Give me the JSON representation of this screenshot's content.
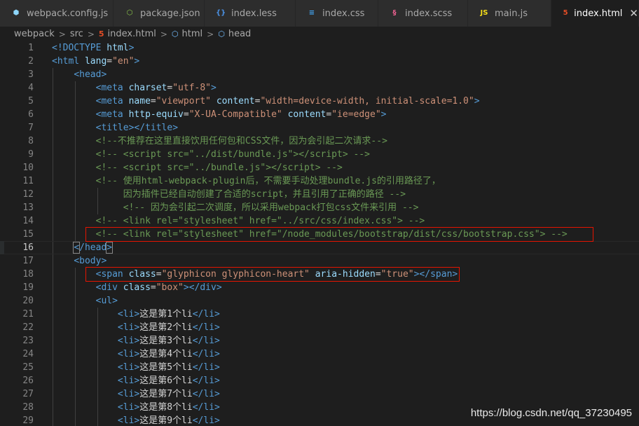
{
  "tabs": [
    {
      "label": "webpack.config.js",
      "icon": "webpack-icon",
      "color": "#8ed6fb",
      "glyph": "⬢"
    },
    {
      "label": "package.json",
      "icon": "node-icon",
      "color": "#8cc84b",
      "glyph": "⬡"
    },
    {
      "label": "index.less",
      "icon": "braces-icon",
      "color": "#4a90e2",
      "glyph": "{}"
    },
    {
      "label": "index.css",
      "icon": "css3-icon",
      "color": "#42a5f5",
      "glyph": "≡"
    },
    {
      "label": "index.scss",
      "icon": "sass-icon",
      "color": "#f06292",
      "glyph": "§"
    },
    {
      "label": "main.js",
      "icon": "javascript-icon",
      "color": "#f5de19",
      "glyph": "JS"
    },
    {
      "label": "index.html",
      "icon": "html5-icon",
      "color": "#e44d26",
      "glyph": "5",
      "active": true,
      "close": "✕"
    }
  ],
  "breadcrumb": [
    "webpack",
    "src",
    "index.html",
    "html",
    "head"
  ],
  "lines": [
    {
      "n": "1",
      "html": "<span class='t'>&lt;!DOCTYPE</span> <span class='a'>html</span><span class='t'>&gt;</span>"
    },
    {
      "n": "2",
      "html": "<span class='t'>&lt;html</span> <span class='a'>lang</span><span class='txt'>=</span><span class='s'>\"en\"</span><span class='t'>&gt;</span>"
    },
    {
      "n": "3",
      "html": "    <span class='t'>&lt;head&gt;</span>"
    },
    {
      "n": "4",
      "html": "        <span class='t'>&lt;meta</span> <span class='a'>charset</span><span class='txt'>=</span><span class='s'>\"utf-8\"</span><span class='t'>&gt;</span>"
    },
    {
      "n": "5",
      "html": "        <span class='t'>&lt;meta</span> <span class='a'>name</span><span class='txt'>=</span><span class='s'>\"viewport\"</span> <span class='a'>content</span><span class='txt'>=</span><span class='s'>\"width=device-width, initial-scale=1.0\"</span><span class='t'>&gt;</span>"
    },
    {
      "n": "6",
      "html": "        <span class='t'>&lt;meta</span> <span class='a'>http-equiv</span><span class='txt'>=</span><span class='s'>\"X-UA-Compatible\"</span> <span class='a'>content</span><span class='txt'>=</span><span class='s'>\"ie=edge\"</span><span class='t'>&gt;</span>"
    },
    {
      "n": "7",
      "html": "        <span class='t'>&lt;title&gt;&lt;/title&gt;</span>"
    },
    {
      "n": "8",
      "html": "        <span class='c'>&lt;!--不推荐在这里直接饮用任何包和CSS文件，因为会引起二次请求--&gt;</span>"
    },
    {
      "n": "9",
      "html": "        <span class='c'>&lt;!-- &lt;script src=\"../dist/bundle.js\"&gt;&lt;/script&gt; --&gt;</span>"
    },
    {
      "n": "10",
      "html": "        <span class='c'>&lt;!-- &lt;script src=\"../bundle.js\"&gt;&lt;/script&gt; --&gt;</span>"
    },
    {
      "n": "11",
      "html": "        <span class='c'>&lt;!-- 使用html-webpack-plugin后，不需要手动处理bundle.js的引用路径了，</span>"
    },
    {
      "n": "12",
      "html": "             <span class='c'>因为插件已经自动创建了合适的script，并且引用了正确的路径 --&gt;</span>"
    },
    {
      "n": "13",
      "html": "             <span class='c'>&lt;!-- 因为会引起二次调度，所以采用webpack打包css文件来引用 --&gt;</span>"
    },
    {
      "n": "14",
      "html": "        <span class='c'>&lt;!-- &lt;link rel=\"stylesheet\" href=\"../src/css/index.css\"&gt; --&gt;</span>"
    },
    {
      "n": "15",
      "html": "        <span class='c'>&lt;!-- &lt;link rel=\"stylesheet\" href=\"/node_modules/bootstrap/dist/css/bootstrap.css\"&gt; --&gt;</span>"
    },
    {
      "n": "16",
      "html": "    <span class='t bm'>&lt;</span><span class='t'>/head</span><span class='t bm'>&gt;</span>",
      "current": true
    },
    {
      "n": "17",
      "html": "    <span class='t'>&lt;body&gt;</span>"
    },
    {
      "n": "18",
      "html": "        <span class='t'>&lt;span</span> <span class='a'>class</span><span class='txt'>=</span><span class='s'>\"glyphicon glyphicon-heart\"</span> <span class='a'>aria-hidden</span><span class='txt'>=</span><span class='s'>\"true\"</span><span class='t'>&gt;&lt;/span&gt;</span>"
    },
    {
      "n": "19",
      "html": "        <span class='t'>&lt;div</span> <span class='a'>class</span><span class='txt'>=</span><span class='s'>\"box\"</span><span class='t'>&gt;&lt;/div&gt;</span>"
    },
    {
      "n": "20",
      "html": "        <span class='t'>&lt;ul&gt;</span>"
    },
    {
      "n": "21",
      "html": "            <span class='t'>&lt;li&gt;</span><span class='txt'>这是第1个li</span><span class='t'>&lt;/li&gt;</span>"
    },
    {
      "n": "22",
      "html": "            <span class='t'>&lt;li&gt;</span><span class='txt'>这是第2个li</span><span class='t'>&lt;/li&gt;</span>"
    },
    {
      "n": "23",
      "html": "            <span class='t'>&lt;li&gt;</span><span class='txt'>这是第3个li</span><span class='t'>&lt;/li&gt;</span>"
    },
    {
      "n": "24",
      "html": "            <span class='t'>&lt;li&gt;</span><span class='txt'>这是第4个li</span><span class='t'>&lt;/li&gt;</span>"
    },
    {
      "n": "25",
      "html": "            <span class='t'>&lt;li&gt;</span><span class='txt'>这是第5个li</span><span class='t'>&lt;/li&gt;</span>"
    },
    {
      "n": "26",
      "html": "            <span class='t'>&lt;li&gt;</span><span class='txt'>这是第6个li</span><span class='t'>&lt;/li&gt;</span>"
    },
    {
      "n": "27",
      "html": "            <span class='t'>&lt;li&gt;</span><span class='txt'>这是第7个li</span><span class='t'>&lt;/li&gt;</span>"
    },
    {
      "n": "28",
      "html": "            <span class='t'>&lt;li&gt;</span><span class='txt'>这是第8个li</span><span class='t'>&lt;/li&gt;</span>"
    },
    {
      "n": "29",
      "html": "            <span class='t'>&lt;li&gt;</span><span class='txt'>这是第9个li</span><span class='t'>&lt;/li&gt;</span>"
    }
  ],
  "highlighted_lines": [
    "15",
    "18"
  ],
  "watermark": "https://blog.csdn.net/qq_37230495",
  "colors": {
    "tag": "#569cd6",
    "attr": "#9cdcfe",
    "string": "#ce9178",
    "comment": "#6a9955",
    "highlight_box": "#e51400"
  }
}
